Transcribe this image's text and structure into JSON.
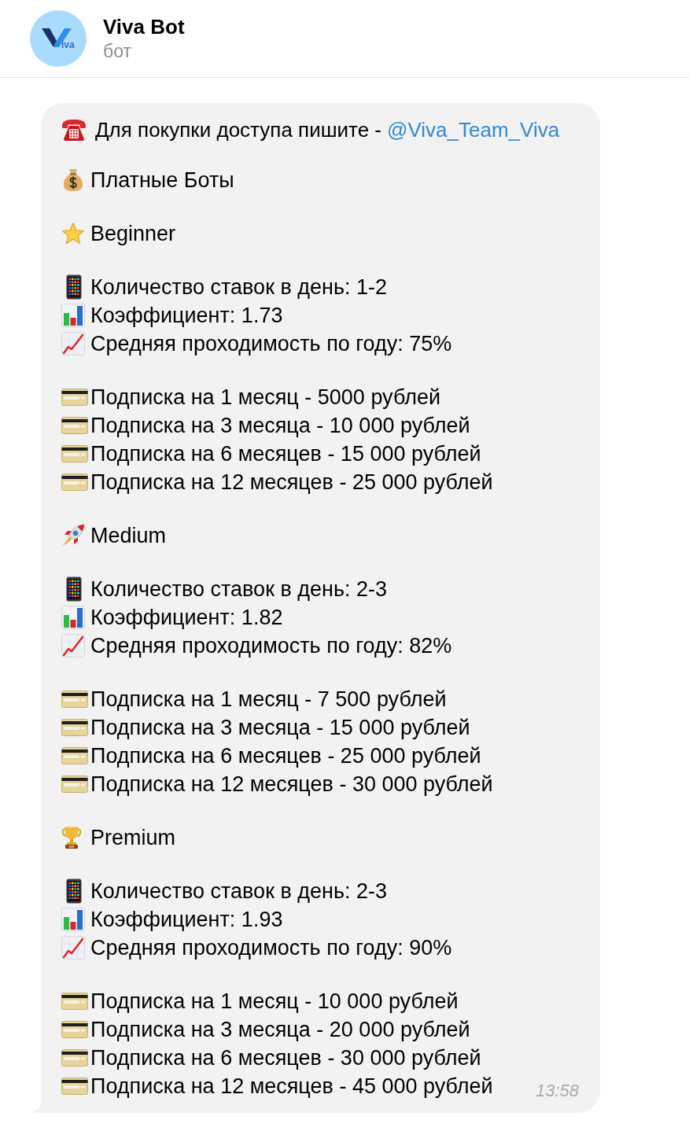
{
  "header": {
    "avatar": {
      "logo_text": "iva"
    },
    "title": "Viva Bot",
    "subtitle": "бот"
  },
  "message": {
    "contact": {
      "text": "Для покупки доступа пишите -",
      "link": "@Viva_Team_Viva"
    },
    "heading": "Платные Боты",
    "plans": [
      {
        "kind": "star",
        "name": "Beginner",
        "stats": [
          {
            "kind": "phone",
            "text": "Количество ставок в день: 1-2"
          },
          {
            "kind": "bars",
            "text": "Коэффициент: 1.73"
          },
          {
            "kind": "trend",
            "text": "Средняя проходимость по году: 75%"
          }
        ],
        "subscriptions": [
          "Подписка на 1 месяц - 5000 рублей",
          "Подписка на 3 месяца - 10 000 рублей",
          "Подписка на 6 месяцев - 15 000 рублей",
          "Подписка на 12 месяцев - 25 000 рублей"
        ]
      },
      {
        "kind": "rocket",
        "name": "Medium",
        "stats": [
          {
            "kind": "phone",
            "text": "Количество ставок в день: 2-3"
          },
          {
            "kind": "bars",
            "text": "Коэффициент: 1.82"
          },
          {
            "kind": "trend",
            "text": "Средняя проходимость по году: 82%"
          }
        ],
        "subscriptions": [
          "Подписка на 1 месяц - 7 500 рублей",
          "Подписка на 3 месяца - 15 000 рублей",
          "Подписка на 6 месяцев - 25 000 рублей",
          "Подписка на 12 месяцев - 30 000 рублей"
        ]
      },
      {
        "kind": "trophy",
        "name": "Premium",
        "stats": [
          {
            "kind": "phone",
            "text": "Количество ставок в день: 2-3"
          },
          {
            "kind": "bars",
            "text": "Коэффициент: 1.93"
          },
          {
            "kind": "trend",
            "text": "Средняя проходимость по году: 90%"
          }
        ],
        "subscriptions": [
          "Подписка на 1 месяц - 10 000 рублей",
          "Подписка на 3 месяца - 20 000 рублей",
          "Подписка на 6 месяцев - 30 000 рублей",
          "Подписка на 12 месяцев - 45 000 рублей"
        ]
      }
    ],
    "time": "13:58"
  }
}
